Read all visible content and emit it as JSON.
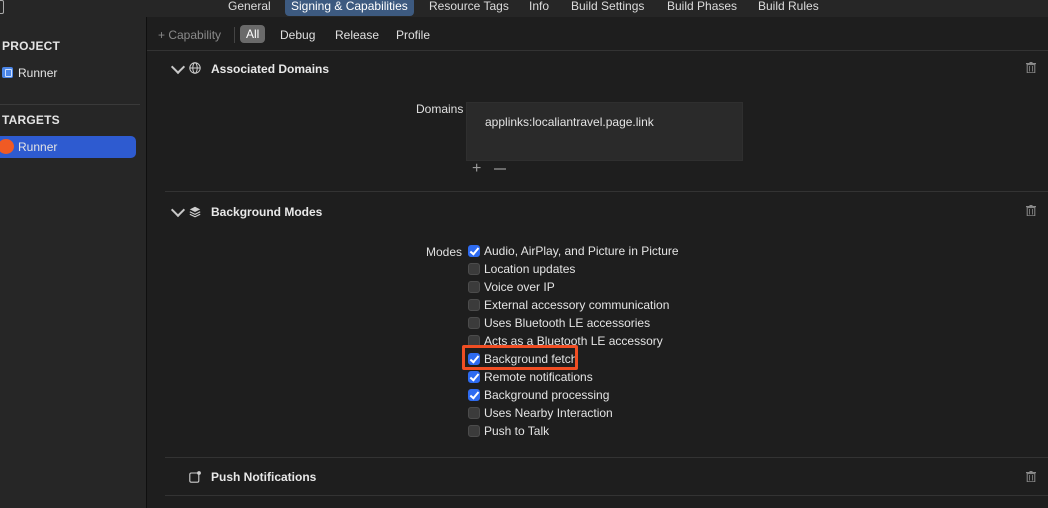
{
  "tabs": [
    {
      "label": "General",
      "selected": false
    },
    {
      "label": "Signing & Capabilities",
      "selected": true
    },
    {
      "label": "Resource Tags",
      "selected": false
    },
    {
      "label": "Info",
      "selected": false
    },
    {
      "label": "Build Settings",
      "selected": false
    },
    {
      "label": "Build Phases",
      "selected": false
    },
    {
      "label": "Build Rules",
      "selected": false
    }
  ],
  "sidebar": {
    "project_heading": "PROJECT",
    "project_item": "Runner",
    "targets_heading": "TARGETS",
    "target_item": "Runner"
  },
  "filterbar": {
    "add_capability": "+ Capability",
    "filters": [
      "All",
      "Debug",
      "Release",
      "Profile"
    ],
    "active_filter": "All"
  },
  "associated_domains": {
    "title": "Associated Domains",
    "field_label": "Domains",
    "entries": [
      "applinks:localiantravel.page.link"
    ],
    "add_glyph": "+"
  },
  "background_modes": {
    "title": "Background Modes",
    "field_label": "Modes",
    "modes": [
      {
        "label": "Audio, AirPlay, and Picture in Picture",
        "checked": true
      },
      {
        "label": "Location updates",
        "checked": false
      },
      {
        "label": "Voice over IP",
        "checked": false
      },
      {
        "label": "External accessory communication",
        "checked": false
      },
      {
        "label": "Uses Bluetooth LE accessories",
        "checked": false
      },
      {
        "label": "Acts as a Bluetooth LE accessory",
        "checked": false
      },
      {
        "label": "Background fetch",
        "checked": true
      },
      {
        "label": "Remote notifications",
        "checked": true
      },
      {
        "label": "Background processing",
        "checked": true
      },
      {
        "label": "Uses Nearby Interaction",
        "checked": false
      },
      {
        "label": "Push to Talk",
        "checked": false
      }
    ],
    "highlighted_mode": "Background fetch"
  },
  "push_notifications": {
    "title": "Push Notifications"
  },
  "colors": {
    "accent": "#2e6bf0",
    "selected_tab": "#3d5a80",
    "sidebar_selection": "#2e5bd0",
    "highlight_box": "#f04e23",
    "target_icon": "#f05a24"
  },
  "icons": {
    "associated_domains": "globe-icon",
    "background_modes": "layers-icon",
    "push_notifications": "notification-badge-icon",
    "delete": "trash-icon",
    "collapse": "chevron-down-icon"
  }
}
